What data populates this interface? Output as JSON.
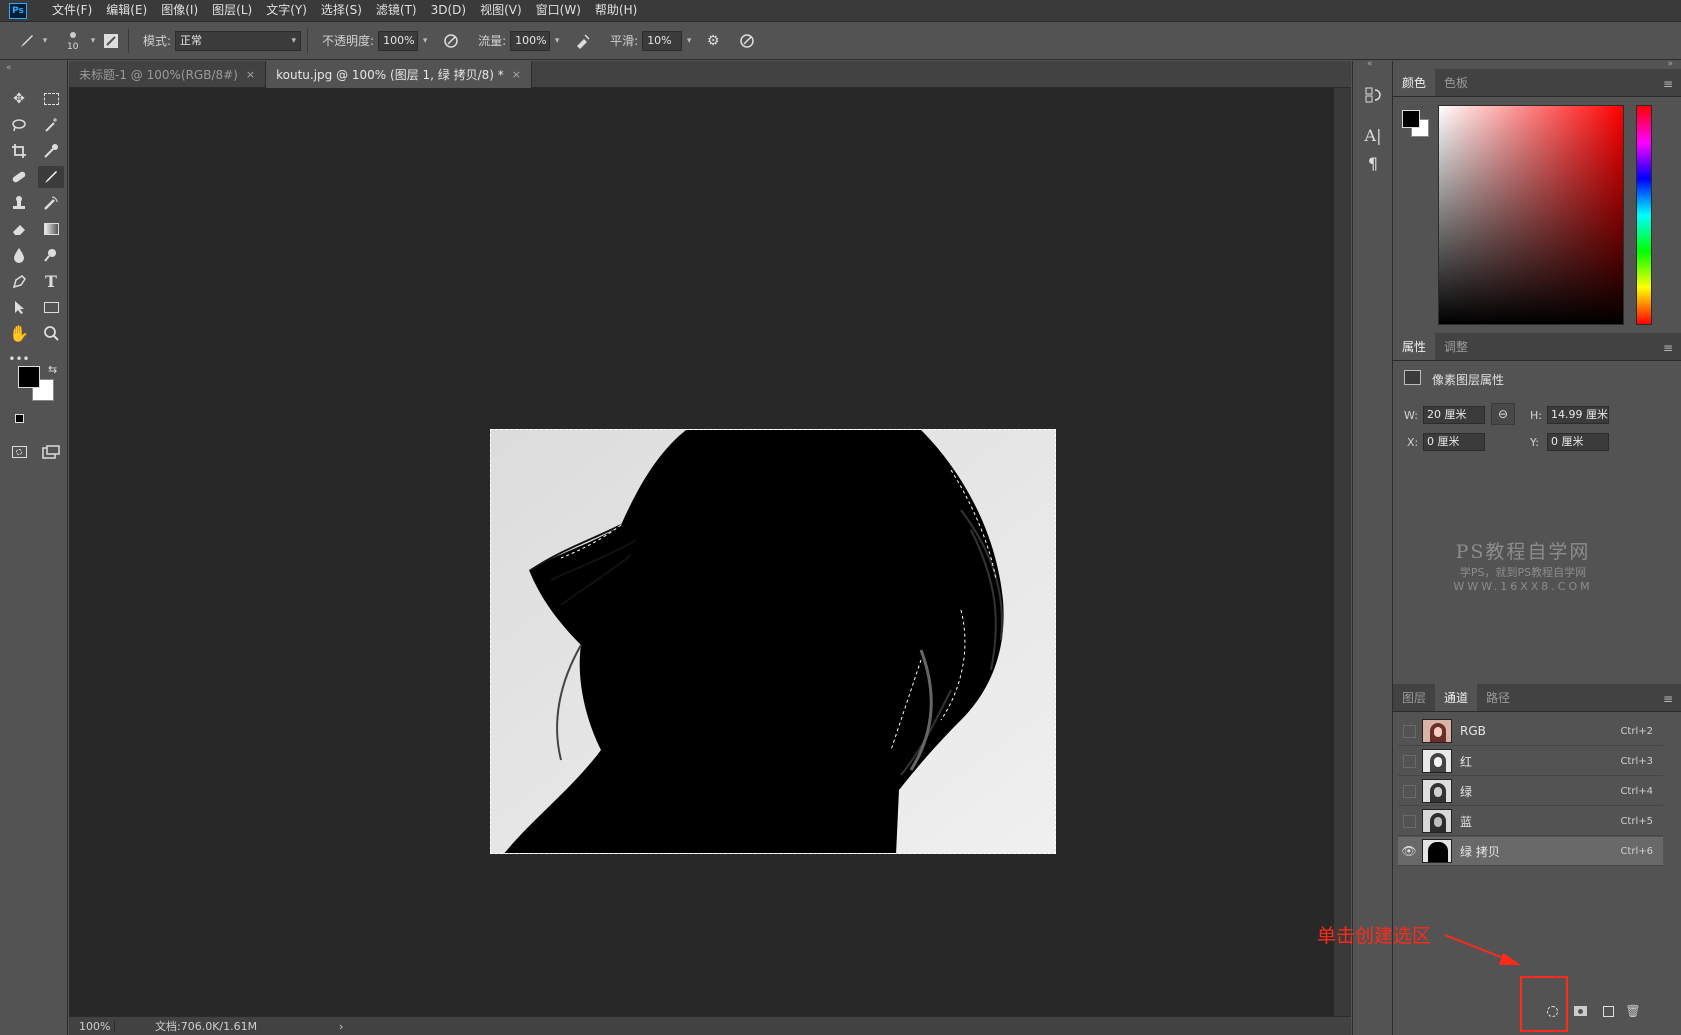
{
  "menubar": {
    "logo": "Ps",
    "items": [
      "文件(F)",
      "编辑(E)",
      "图像(I)",
      "图层(L)",
      "文字(Y)",
      "选择(S)",
      "滤镜(T)",
      "3D(D)",
      "视图(V)",
      "窗口(W)",
      "帮助(H)"
    ]
  },
  "options": {
    "brush_size": "10",
    "mode_label": "模式:",
    "mode_value": "正常",
    "opacity_label": "不透明度:",
    "opacity_value": "100%",
    "flow_label": "流量:",
    "flow_value": "100%",
    "smooth_label": "平滑:",
    "smooth_value": "10%"
  },
  "tabs": [
    {
      "label": "未标题-1 @ 100%(RGB/8#)",
      "close": "×"
    },
    {
      "label": "koutu.jpg @ 100% (图层 1, 绿 拷贝/8) *",
      "close": "×"
    }
  ],
  "status": {
    "zoom": "100%",
    "doc": "文档:706.0K/1.61M",
    "arrow": "›"
  },
  "color_panel": {
    "tabs": [
      "颜色",
      "色板"
    ],
    "foreground": "#000000",
    "background": "#ffffff",
    "hue_base": "#ff0000"
  },
  "properties_panel": {
    "tabs": [
      "属性",
      "调整"
    ],
    "type_label": "像素图层属性",
    "w_label": "W:",
    "w_value": "20 厘米",
    "h_label": "H:",
    "h_value": "14.99 厘米",
    "x_label": "X:",
    "x_value": "0 厘米",
    "y_label": "Y:",
    "y_value": "0 厘米"
  },
  "watermark": {
    "line1": "PS教程自学网",
    "line2": "学PS，就到PS教程自学网",
    "line3": "WWW.16XX8.COM"
  },
  "channels_panel": {
    "tabs": [
      "图层",
      "通道",
      "路径"
    ],
    "rows": [
      {
        "name": "RGB",
        "shortcut": "Ctrl+2"
      },
      {
        "name": "红",
        "shortcut": "Ctrl+3"
      },
      {
        "name": "绿",
        "shortcut": "Ctrl+4"
      },
      {
        "name": "蓝",
        "shortcut": "Ctrl+5"
      },
      {
        "name": "绿 拷贝",
        "shortcut": "Ctrl+6"
      }
    ]
  },
  "annotation": {
    "text": "单击创建选区",
    "color": "#ff2a1a"
  }
}
